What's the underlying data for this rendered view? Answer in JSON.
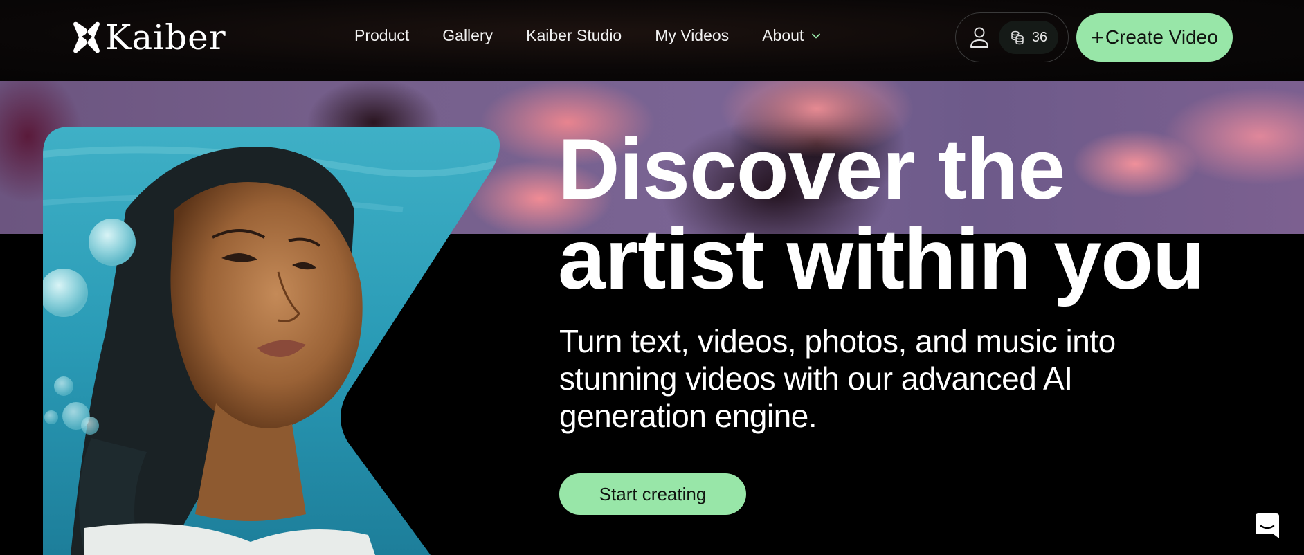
{
  "brand": {
    "name": "Kaiber",
    "accent_color": "#98e6a8"
  },
  "nav": {
    "items": [
      {
        "label": "Product"
      },
      {
        "label": "Gallery"
      },
      {
        "label": "Kaiber Studio"
      },
      {
        "label": "My Videos"
      },
      {
        "label": "About",
        "has_dropdown": true
      }
    ]
  },
  "account": {
    "user_icon": "user-icon",
    "credits_icon": "coins-icon",
    "credits": "36"
  },
  "header_cta": {
    "icon": "plus-icon",
    "label": "Create Video"
  },
  "hero": {
    "title_line1": "Discover the",
    "title_line2": "artist within you",
    "subtitle_line1": "Turn text, videos, photos, and music into",
    "subtitle_line2": "stunning videos with our advanced AI",
    "subtitle_line3": "generation engine.",
    "cta_label": "Start creating",
    "image_alt": "AI-generated portrait of a woman underwater with bubbles"
  },
  "chat_widget": {
    "icon": "chat-bubble-icon"
  }
}
